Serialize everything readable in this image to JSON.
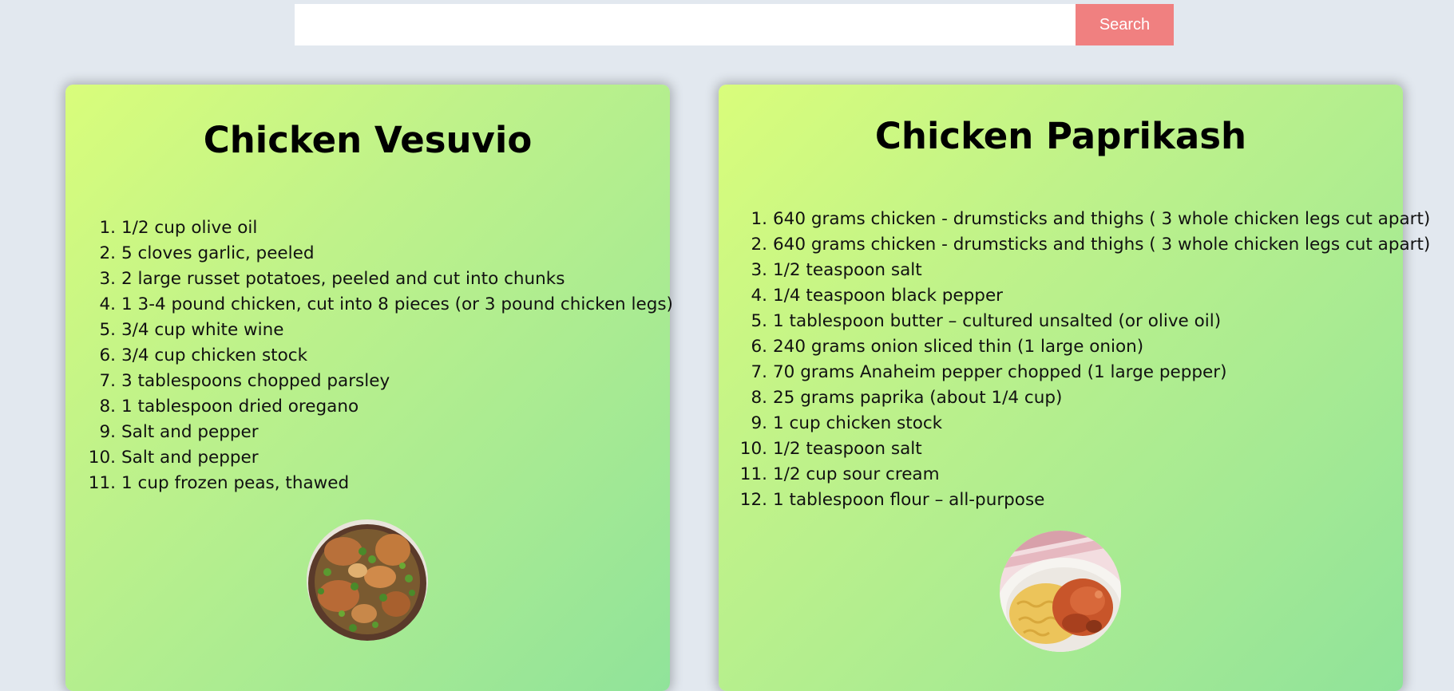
{
  "search": {
    "value": "",
    "placeholder": "",
    "button_label": "Search"
  },
  "recipes": [
    {
      "title": "Chicken Vesuvio",
      "ingredients": [
        {
          "num": "1.",
          "text": "1/2 cup olive oil"
        },
        {
          "num": "2.",
          "text": "5 cloves garlic, peeled"
        },
        {
          "num": "3.",
          "text": "2 large russet potatoes, peeled and cut into chunks"
        },
        {
          "num": "4.",
          "text": "1 3-4 pound chicken, cut into 8 pieces (or 3 pound chicken legs)"
        },
        {
          "num": "5.",
          "text": "3/4 cup white wine"
        },
        {
          "num": "6.",
          "text": "3/4 cup chicken stock"
        },
        {
          "num": "7.",
          "text": "3 tablespoons chopped parsley"
        },
        {
          "num": "8.",
          "text": "1 tablespoon dried oregano"
        },
        {
          "num": "9.",
          "text": "Salt and pepper"
        },
        {
          "num": "10.",
          "text": "Salt and pepper"
        },
        {
          "num": "11.",
          "text": "1 cup frozen peas, thawed"
        }
      ],
      "photo_icon": "chicken-vesuvio-photo"
    },
    {
      "title": "Chicken Paprikash",
      "ingredients": [
        {
          "num": "1.",
          "text": "640 grams chicken - drumsticks and thighs ( 3 whole chicken legs cut apart)"
        },
        {
          "num": "2.",
          "text": "640 grams chicken - drumsticks and thighs ( 3 whole chicken legs cut apart)"
        },
        {
          "num": "3.",
          "text": "1/2 teaspoon salt"
        },
        {
          "num": "4.",
          "text": "1/4 teaspoon black pepper"
        },
        {
          "num": "5.",
          "text": "1 tablespoon butter – cultured unsalted (or olive oil)"
        },
        {
          "num": "6.",
          "text": "240 grams onion sliced thin (1 large onion)"
        },
        {
          "num": "7.",
          "text": "70 grams Anaheim pepper chopped (1 large pepper)"
        },
        {
          "num": "8.",
          "text": "25 grams paprika (about 1/4 cup)"
        },
        {
          "num": "9.",
          "text": "1 cup chicken stock"
        },
        {
          "num": "10.",
          "text": "1/2 teaspoon salt"
        },
        {
          "num": "11.",
          "text": "1/2 cup sour cream"
        },
        {
          "num": "12.",
          "text": "1 tablespoon flour – all-purpose"
        }
      ],
      "photo_icon": "chicken-paprikash-photo"
    }
  ],
  "colors": {
    "page_background": "#e2e8ef",
    "search_button": "#f08080",
    "card_gradient_start": "#d9fd7b",
    "card_gradient_end": "#90e39a"
  }
}
